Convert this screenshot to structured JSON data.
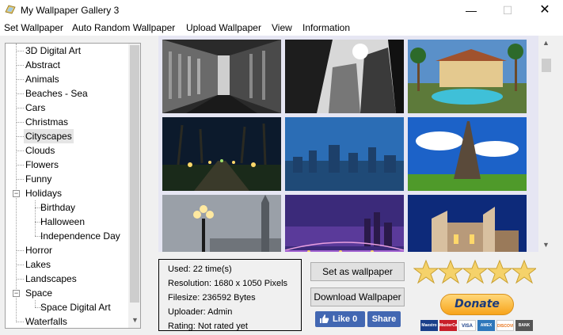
{
  "window": {
    "title": "My Wallpaper Gallery 3",
    "minimize": "—",
    "maximize": "☐",
    "close": "✕"
  },
  "menu": [
    "Set Wallpaper",
    "Auto Random Wallpaper",
    "Upload Wallpaper",
    "View",
    "Information"
  ],
  "tree": {
    "items": [
      "3D Digital Art",
      "Abstract",
      "Animals",
      "Beaches - Sea",
      "Cars",
      "Christmas",
      "Cityscapes",
      "Clouds",
      "Flowers",
      "Funny",
      "Holidays",
      "Birthday",
      "Halloween",
      "Independence Day",
      "Horror",
      "Lakes",
      "Landscapes",
      "Space",
      "Space Digital Art",
      "Waterfalls"
    ],
    "selected": "Cityscapes",
    "expander_symbol": "−",
    "scroll_down": "▼"
  },
  "gallery": {
    "scroll_up": "▲",
    "scroll_down": "▼",
    "thumbnails": [
      "bw-city-street",
      "bw-skyscrapers",
      "resort-pool",
      "night-park-lights",
      "blue-city-dots",
      "eiffel-tower",
      "foggy-lamp-bigben",
      "brooklyn-bridge-night",
      "blue-castle-night"
    ]
  },
  "info": {
    "used": "Used: 22 time(s)",
    "resolution": "Resolution: 1680 x 1050 Pixels",
    "filesize": "Filesize: 236592 Bytes",
    "uploader": "Uploader: Admin",
    "rating": "Rating: Not rated yet"
  },
  "buttons": {
    "set_wallpaper": "Set as wallpaper",
    "download": "Download Wallpaper",
    "like": "Like 0",
    "share": "Share",
    "donate": "Donate"
  },
  "rating_stars": 5,
  "payment_cards": [
    "Maestro",
    "MasterCard",
    "VISA",
    "AMEX",
    "DISCOVER",
    "BANK"
  ],
  "colors": {
    "facebook": "#4267b2",
    "star": "#f2c94c",
    "donate": "#f7a41b"
  }
}
